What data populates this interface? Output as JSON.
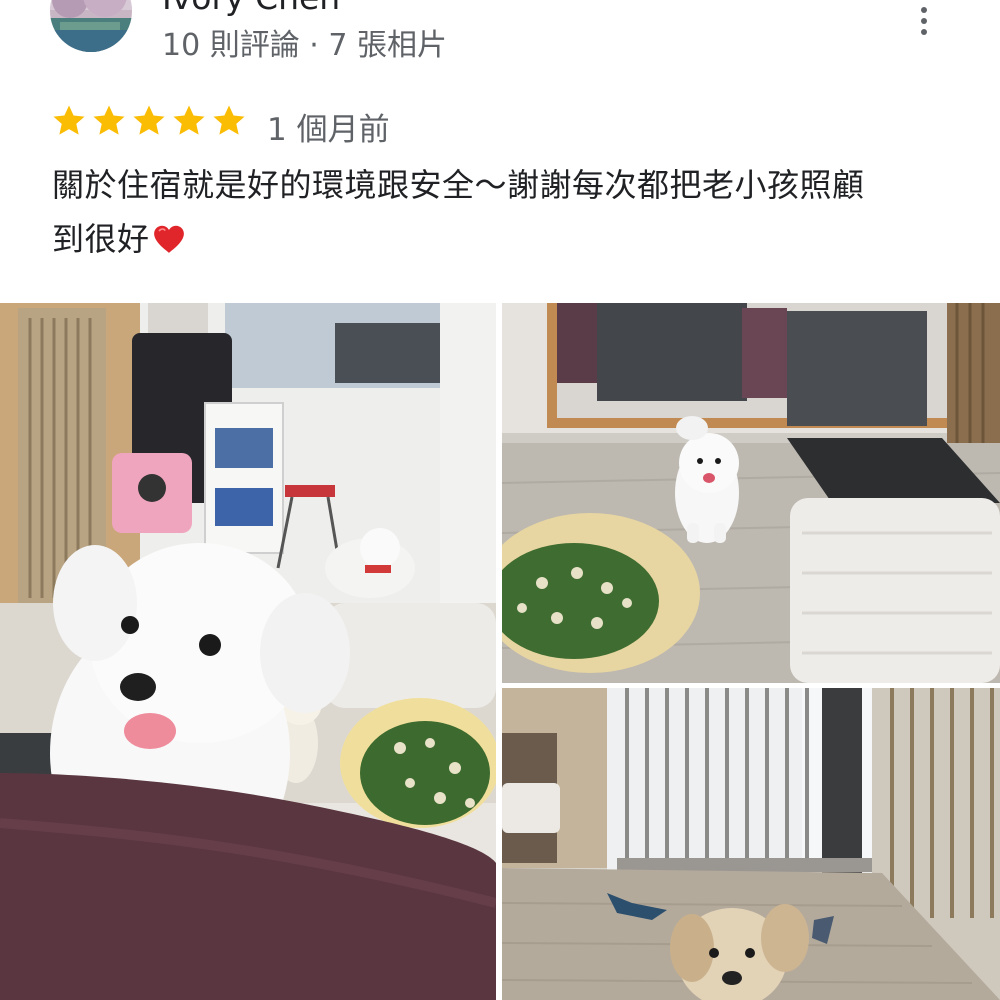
{
  "reviewer": {
    "name": "Ivory Chen",
    "meta": "10 則評論 · 7 張相片"
  },
  "review": {
    "rating": 5,
    "date": "1 個月前",
    "text_line1": "關於住宿就是好的環境跟安全～謝謝每次都把老小孩照顧",
    "text_line2": "到很好"
  },
  "icons": {
    "star": "star-icon",
    "heart": "heart-emoji",
    "more": "more-vert-icon"
  },
  "colors": {
    "star": "#fbbc04",
    "heart": "#e0262b",
    "meta_text": "#5f6368"
  }
}
